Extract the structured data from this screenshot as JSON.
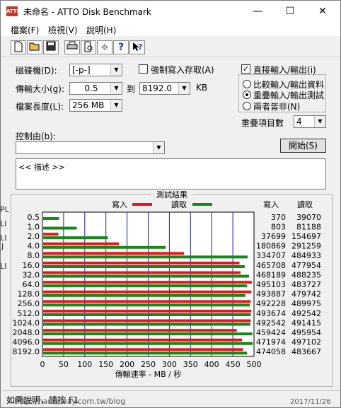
{
  "window": {
    "title": "未命名 - ATTO Disk Benchmark",
    "icon_name": "atto-app-icon",
    "controls": {
      "minimize": "—",
      "maximize": "☐",
      "close": "✕"
    }
  },
  "menu": [
    "檔案(F)",
    "檢視(V)",
    "說明(H)"
  ],
  "toolbar": {
    "icons": [
      "new-document-icon",
      "open-folder-icon",
      "save-disk-icon",
      "print-icon",
      "print-preview-icon",
      "move-icon",
      "help-icon",
      "context-help-icon"
    ]
  },
  "settings": {
    "drive_label": "磁碟機(D):",
    "drive_value": "[-p-]",
    "force_write_label": "強制寫入存取(A)",
    "force_write_checked": false,
    "transfer_label": "傳輸大小(g):",
    "transfer_from": "0.5",
    "to_label": "到",
    "transfer_to": "8192.0",
    "kb_label": "KB",
    "filesize_label": "檔案長度(L):",
    "filesize_value": "256 MB",
    "direct_io_label": "直接輸入/輸出(i)",
    "direct_io_checked": true,
    "radio_compare": "比較輸入/輸出資料",
    "radio_overlap": "重疊輸入/輸出測試",
    "radio_neither": "兩者皆非(N)",
    "selected_radio": "overlap",
    "queue_label": "重疊項目數",
    "queue_value": "4",
    "control_label": "控制由(b):",
    "control_value": "",
    "start_button": "開始(S)",
    "description": "<< 描述 >>"
  },
  "results": {
    "group_title": "測試結果",
    "legend_write": "寫入",
    "legend_read": "讀取",
    "col_write": "寫入",
    "col_read": "讀取",
    "write_values": [
      "370",
      "803",
      "37699",
      "180869",
      "334707",
      "465708",
      "468189",
      "495103",
      "493887",
      "492228",
      "493674",
      "492542",
      "459424",
      "471974",
      "474058"
    ],
    "read_values": [
      "39070",
      "81188",
      "154697",
      "291259",
      "484933",
      "477954",
      "488235",
      "483727",
      "479742",
      "489975",
      "492542",
      "491415",
      "495954",
      "497102",
      "483667"
    ]
  },
  "chart_data": {
    "type": "bar",
    "orientation": "horizontal",
    "categories": [
      "0.5",
      "1.0",
      "2.0",
      "4.0",
      "8.0",
      "16.0",
      "32.0",
      "64.0",
      "128.0",
      "256.0",
      "512.0",
      "1024.0",
      "2048.0",
      "4096.0",
      "8192.0"
    ],
    "series": [
      {
        "name": "寫入",
        "color": "#e8141a",
        "values": [
          0.37,
          0.8,
          37.7,
          180.9,
          334.7,
          465.7,
          468.2,
          495.1,
          493.9,
          492.2,
          493.7,
          492.5,
          459.4,
          472.0,
          474.1
        ]
      },
      {
        "name": "讀取",
        "color": "#138a17",
        "values": [
          39.1,
          81.2,
          154.7,
          291.3,
          484.9,
          478.0,
          488.2,
          483.7,
          479.7,
          490.0,
          492.5,
          491.4,
          496.0,
          497.1,
          483.7
        ]
      }
    ],
    "xlim": [
      0,
      500
    ],
    "xticks": [
      "0",
      "50",
      "100",
      "150",
      "200",
      "250",
      "300",
      "350",
      "400",
      "450",
      "500"
    ],
    "xlabel": "傳輸速率 - MB / 秒",
    "grid": true,
    "grid_color": "#1a1aaa",
    "legend": "top"
  },
  "status": {
    "text": "如需說明，請按 F1"
  },
  "background_fragments": {
    "left_edge": [
      "PL",
      "LI",
      "LI",
      "J",
      "LI"
    ],
    "bottom_strip": "http://hardaway.com.tw/blog",
    "bottom_right_date": "2017/11/26"
  }
}
